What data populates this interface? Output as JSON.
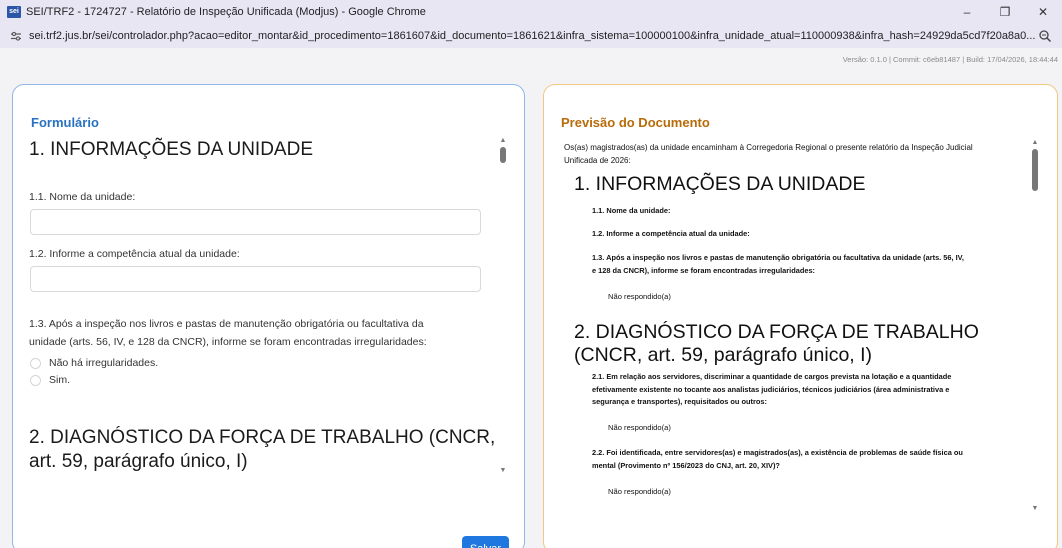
{
  "window": {
    "favicon_text": "sei",
    "title": "SEI/TRF2 - 1724727 - Relatório de Inspeção Unificada (Modjus) - Google Chrome",
    "minimize": "–",
    "restore": "❐",
    "close": "✕"
  },
  "address": {
    "url": "sei.trf2.jus.br/sei/controlador.php?acao=editor_montar&id_procedimento=1861607&id_documento=1861621&infra_sistema=100000100&infra_unidade_atual=110000938&infra_hash=24929da5cd7f20a8a0..."
  },
  "version_text": "Versão: 0.1.0 | Commit: c6eb81487 | Build: 17/04/2026, 18:44:44",
  "form": {
    "heading": "Formulário",
    "section1_title": "1. INFORMAÇÕES DA UNIDADE",
    "q1_label": "1.1. Nome da unidade:",
    "q1_value": "",
    "q2_label": "1.2. Informe a competência atual da unidade:",
    "q2_value": "",
    "q3_label_line1": "1.3. Após a inspeção nos livros e pastas de manutenção obrigatória ou facultativa da",
    "q3_label_line2": "unidade (arts. 56, IV, e 128 da CNCR), informe se foram encontradas irregularidades:",
    "q3_options": [
      "Não há irregularidades.",
      "Sim."
    ],
    "section2_title_line1": "2. DIAGNÓSTICO DA FORÇA DE TRABALHO (CNCR,",
    "section2_title_line2": "art. 59, parágrafo único, I)",
    "save_label": "Salvar"
  },
  "preview": {
    "heading": "Previsão do Documento",
    "intro_line1": "Os(as) magistrados(as) da unidade encaminham à Corregedoria Regional o presente relatório da Inspeção Judicial",
    "intro_line2": "Unificada de 2026:",
    "s1_title": "1. INFORMAÇÕES DA UNIDADE",
    "s1_q1": "1.1. Nome da unidade:",
    "s1_q2": "1.2. Informe a competência atual da unidade:",
    "s1_q3_line1": "1.3. Após a inspeção nos livros e pastas de manutenção obrigatória ou facultativa da unidade (arts. 56, IV,",
    "s1_q3_line2": "e 128 da CNCR), informe se foram encontradas irregularidades:",
    "s1_q3_answer": "Não respondido(a)",
    "s2_title_line1": "2. DIAGNÓSTICO DA FORÇA DE TRABALHO",
    "s2_title_line2": "(CNCR, art. 59, parágrafo único, I)",
    "s2_q1_line1": "2.1. Em relação aos servidores, discriminar a quantidade de cargos prevista na lotação e a quantidade",
    "s2_q1_line2": "efetivamente existente no tocante aos analistas judiciários, técnicos judiciários (área administrativa e",
    "s2_q1_line3": "segurança e transportes), requisitados ou outros:",
    "s2_q1_answer": "Não respondido(a)",
    "s2_q2_line1": "2.2. Foi identificada, entre servidores(as) e magistrados(as), a existência de problemas de saúde física ou",
    "s2_q2_line2": "mental (Provimento nº 156/2023 do CNJ, art. 20, XIV)?",
    "s2_q2_answer": "Não respondido(a)"
  },
  "colors": {
    "form_accent": "#2a72bf",
    "preview_accent": "#b86b09",
    "save_button": "#1f78e0"
  }
}
